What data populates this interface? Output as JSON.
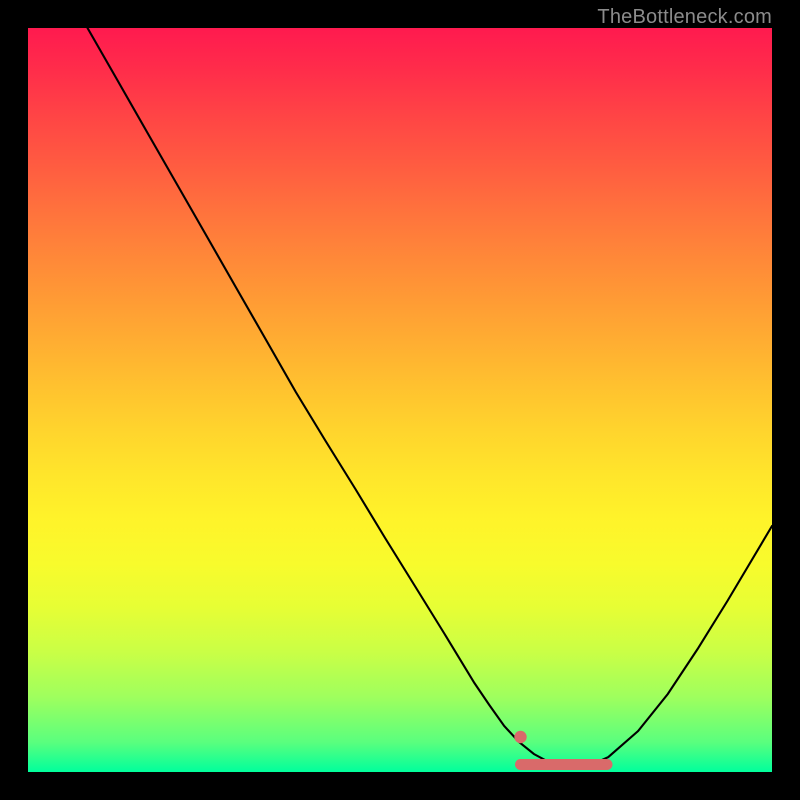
{
  "attribution": {
    "text": "TheBottleneck.com"
  },
  "colors": {
    "background": "#000000",
    "gradient_top": "#ff1a4f",
    "gradient_bottom": "#00ff9c",
    "curve": "#000000",
    "marker": "#d96a6a"
  },
  "chart_data": {
    "type": "line",
    "title": "",
    "xlabel": "",
    "ylabel": "",
    "xlim": [
      0,
      100
    ],
    "ylim": [
      0,
      100
    ],
    "grid": false,
    "legend": false,
    "series": [
      {
        "name": "curve",
        "x": [
          8,
          12,
          16,
          20,
          24,
          28,
          32,
          36,
          40,
          44,
          48,
          52,
          56,
          60,
          62,
          64,
          66,
          68,
          70,
          72,
          74,
          76,
          78,
          82,
          86,
          90,
          94,
          100
        ],
        "y": [
          100,
          93,
          86,
          79,
          72,
          65,
          58,
          51,
          44.5,
          38,
          31.5,
          25,
          18.5,
          12,
          9,
          6.2,
          4,
          2.4,
          1.4,
          0.9,
          0.8,
          1.1,
          2,
          5.5,
          10.5,
          16.5,
          23,
          33
        ],
        "style": "black-thin"
      }
    ],
    "annotations": [
      {
        "name": "valley-highlight",
        "x_range": [
          66.2,
          77.8
        ],
        "y": 1.0,
        "style": "pink-thick-rounded",
        "note": "flat highlighted segment at curve minimum"
      },
      {
        "name": "valley-dot",
        "x": 66.2,
        "y": 4.7,
        "style": "pink-dot"
      }
    ]
  }
}
